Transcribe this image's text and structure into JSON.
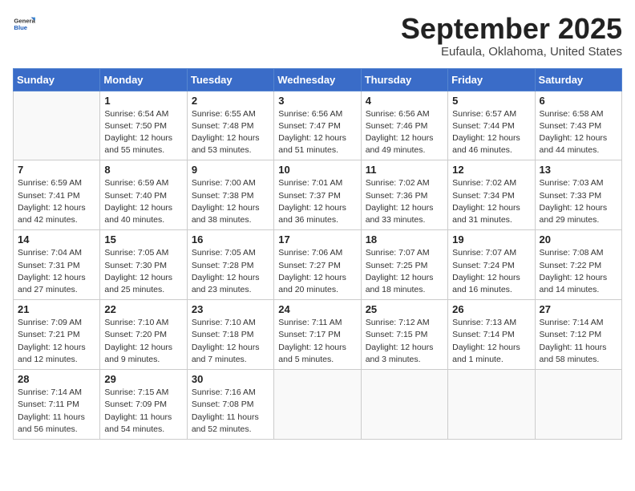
{
  "header": {
    "logo_general": "General",
    "logo_blue": "Blue",
    "month": "September 2025",
    "location": "Eufaula, Oklahoma, United States"
  },
  "weekdays": [
    "Sunday",
    "Monday",
    "Tuesday",
    "Wednesday",
    "Thursday",
    "Friday",
    "Saturday"
  ],
  "weeks": [
    [
      {
        "day": "",
        "info": ""
      },
      {
        "day": "1",
        "info": "Sunrise: 6:54 AM\nSunset: 7:50 PM\nDaylight: 12 hours\nand 55 minutes."
      },
      {
        "day": "2",
        "info": "Sunrise: 6:55 AM\nSunset: 7:48 PM\nDaylight: 12 hours\nand 53 minutes."
      },
      {
        "day": "3",
        "info": "Sunrise: 6:56 AM\nSunset: 7:47 PM\nDaylight: 12 hours\nand 51 minutes."
      },
      {
        "day": "4",
        "info": "Sunrise: 6:56 AM\nSunset: 7:46 PM\nDaylight: 12 hours\nand 49 minutes."
      },
      {
        "day": "5",
        "info": "Sunrise: 6:57 AM\nSunset: 7:44 PM\nDaylight: 12 hours\nand 46 minutes."
      },
      {
        "day": "6",
        "info": "Sunrise: 6:58 AM\nSunset: 7:43 PM\nDaylight: 12 hours\nand 44 minutes."
      }
    ],
    [
      {
        "day": "7",
        "info": "Sunrise: 6:59 AM\nSunset: 7:41 PM\nDaylight: 12 hours\nand 42 minutes."
      },
      {
        "day": "8",
        "info": "Sunrise: 6:59 AM\nSunset: 7:40 PM\nDaylight: 12 hours\nand 40 minutes."
      },
      {
        "day": "9",
        "info": "Sunrise: 7:00 AM\nSunset: 7:38 PM\nDaylight: 12 hours\nand 38 minutes."
      },
      {
        "day": "10",
        "info": "Sunrise: 7:01 AM\nSunset: 7:37 PM\nDaylight: 12 hours\nand 36 minutes."
      },
      {
        "day": "11",
        "info": "Sunrise: 7:02 AM\nSunset: 7:36 PM\nDaylight: 12 hours\nand 33 minutes."
      },
      {
        "day": "12",
        "info": "Sunrise: 7:02 AM\nSunset: 7:34 PM\nDaylight: 12 hours\nand 31 minutes."
      },
      {
        "day": "13",
        "info": "Sunrise: 7:03 AM\nSunset: 7:33 PM\nDaylight: 12 hours\nand 29 minutes."
      }
    ],
    [
      {
        "day": "14",
        "info": "Sunrise: 7:04 AM\nSunset: 7:31 PM\nDaylight: 12 hours\nand 27 minutes."
      },
      {
        "day": "15",
        "info": "Sunrise: 7:05 AM\nSunset: 7:30 PM\nDaylight: 12 hours\nand 25 minutes."
      },
      {
        "day": "16",
        "info": "Sunrise: 7:05 AM\nSunset: 7:28 PM\nDaylight: 12 hours\nand 23 minutes."
      },
      {
        "day": "17",
        "info": "Sunrise: 7:06 AM\nSunset: 7:27 PM\nDaylight: 12 hours\nand 20 minutes."
      },
      {
        "day": "18",
        "info": "Sunrise: 7:07 AM\nSunset: 7:25 PM\nDaylight: 12 hours\nand 18 minutes."
      },
      {
        "day": "19",
        "info": "Sunrise: 7:07 AM\nSunset: 7:24 PM\nDaylight: 12 hours\nand 16 minutes."
      },
      {
        "day": "20",
        "info": "Sunrise: 7:08 AM\nSunset: 7:22 PM\nDaylight: 12 hours\nand 14 minutes."
      }
    ],
    [
      {
        "day": "21",
        "info": "Sunrise: 7:09 AM\nSunset: 7:21 PM\nDaylight: 12 hours\nand 12 minutes."
      },
      {
        "day": "22",
        "info": "Sunrise: 7:10 AM\nSunset: 7:20 PM\nDaylight: 12 hours\nand 9 minutes."
      },
      {
        "day": "23",
        "info": "Sunrise: 7:10 AM\nSunset: 7:18 PM\nDaylight: 12 hours\nand 7 minutes."
      },
      {
        "day": "24",
        "info": "Sunrise: 7:11 AM\nSunset: 7:17 PM\nDaylight: 12 hours\nand 5 minutes."
      },
      {
        "day": "25",
        "info": "Sunrise: 7:12 AM\nSunset: 7:15 PM\nDaylight: 12 hours\nand 3 minutes."
      },
      {
        "day": "26",
        "info": "Sunrise: 7:13 AM\nSunset: 7:14 PM\nDaylight: 12 hours\nand 1 minute."
      },
      {
        "day": "27",
        "info": "Sunrise: 7:14 AM\nSunset: 7:12 PM\nDaylight: 11 hours\nand 58 minutes."
      }
    ],
    [
      {
        "day": "28",
        "info": "Sunrise: 7:14 AM\nSunset: 7:11 PM\nDaylight: 11 hours\nand 56 minutes."
      },
      {
        "day": "29",
        "info": "Sunrise: 7:15 AM\nSunset: 7:09 PM\nDaylight: 11 hours\nand 54 minutes."
      },
      {
        "day": "30",
        "info": "Sunrise: 7:16 AM\nSunset: 7:08 PM\nDaylight: 11 hours\nand 52 minutes."
      },
      {
        "day": "",
        "info": ""
      },
      {
        "day": "",
        "info": ""
      },
      {
        "day": "",
        "info": ""
      },
      {
        "day": "",
        "info": ""
      }
    ]
  ]
}
